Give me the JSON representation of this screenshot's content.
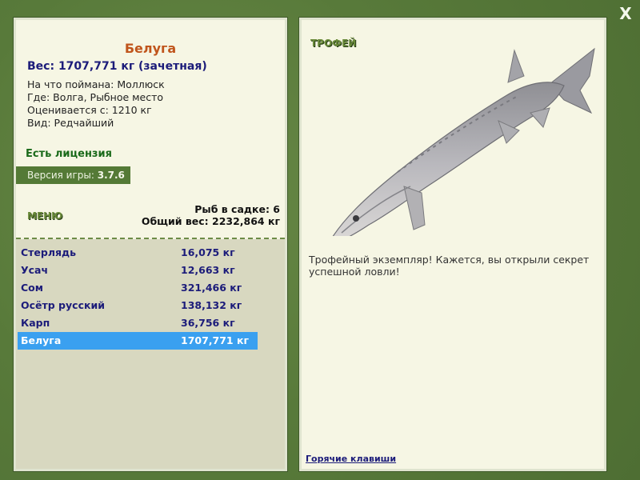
{
  "close_label": "X",
  "selected_fish": {
    "title": "Белуга",
    "weight_line": "Вес: 1707,771 кг (зачетная)",
    "details": [
      "На что поймана: Моллюск",
      "Где: Волга, Рыбное место",
      "Оценивается с: 1210 кг",
      "Вид: Редчайший"
    ]
  },
  "license_text": "Есть лицензия",
  "version": {
    "label": "Версия игры:",
    "value": "3.7.6"
  },
  "menu_label": "МЕНЮ",
  "stats": {
    "fish_in_cage": "Рыб в садке: 6",
    "total_weight": "Общий вес: 2232,864 кг"
  },
  "fish_list": [
    {
      "name": "Стерлядь",
      "weight": "16,075 кг"
    },
    {
      "name": "Усач",
      "weight": "12,663 кг"
    },
    {
      "name": "Сом",
      "weight": "321,466 кг"
    },
    {
      "name": "Осётр русский",
      "weight": "138,132 кг"
    },
    {
      "name": "Карп",
      "weight": "36,756 кг"
    },
    {
      "name": "Белуга",
      "weight": "1707,771 кг",
      "selected": true
    }
  ],
  "trophy": {
    "label": "ТРОФЕЙ",
    "text": "Трофейный экземпляр! Кажется, вы открыли секрет успешной ловли!",
    "image": "beluga-sturgeon"
  },
  "hotkeys_link": "Горячие клавиши",
  "colors": {
    "background": "#5a7a3c",
    "panel": "#f6f6e4",
    "list_bg": "#d8d8c0",
    "accent_title": "#c0551c",
    "text_blue": "#1c1c7a",
    "selection": "#3aa0f0",
    "license_green": "#1a6a1a"
  }
}
